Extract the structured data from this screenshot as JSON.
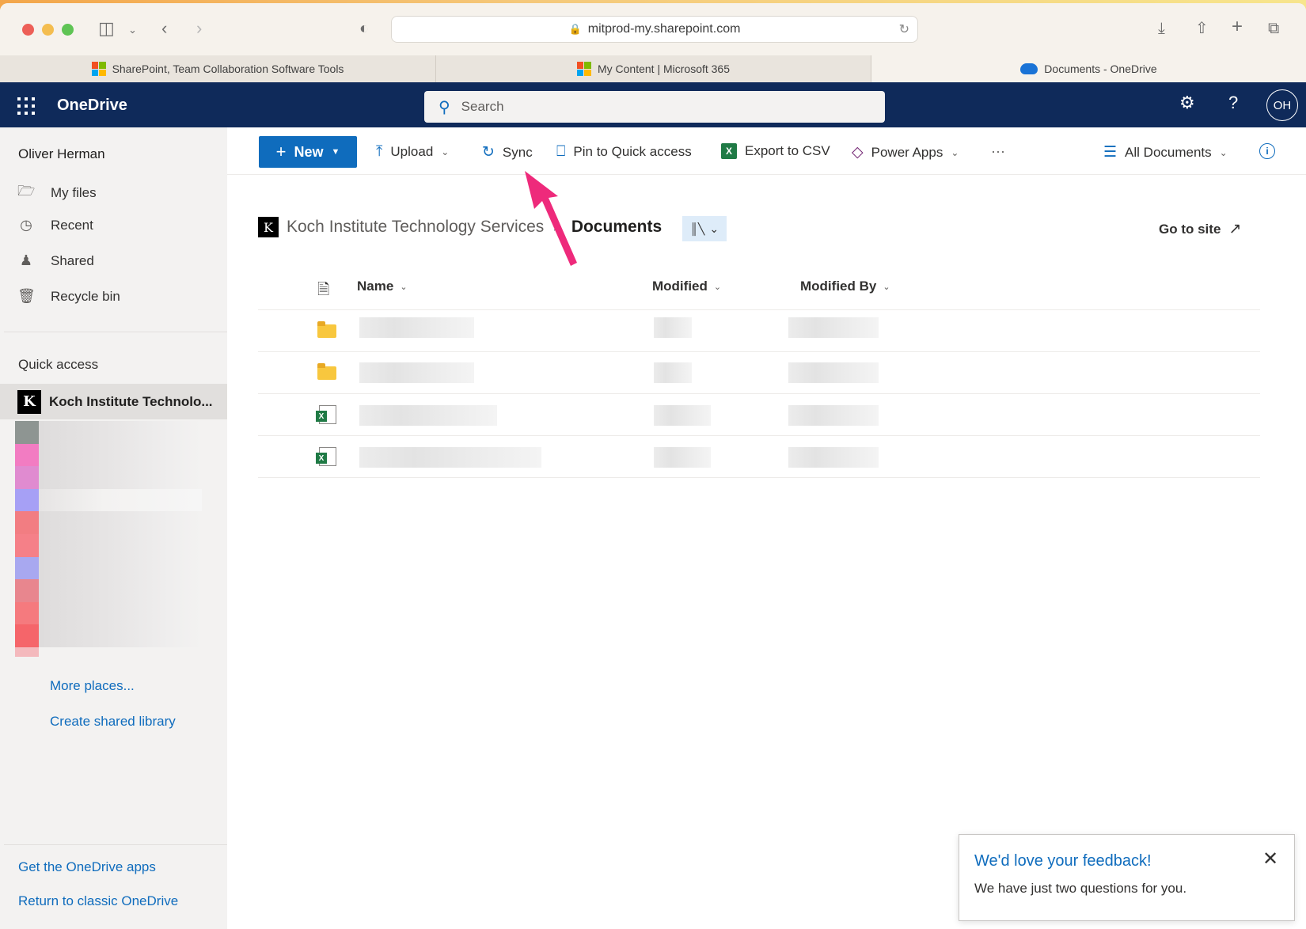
{
  "browser": {
    "url": "mitprod-my.sharepoint.com",
    "tabs": [
      {
        "label": "SharePoint, Team Collaboration Software Tools",
        "active": false
      },
      {
        "label": "My Content | Microsoft 365",
        "active": false
      },
      {
        "label": "Documents - OneDrive",
        "active": true
      }
    ]
  },
  "suite": {
    "brand": "OneDrive",
    "search_placeholder": "Search",
    "avatar_initials": "OH"
  },
  "leftnav": {
    "user": "Oliver Herman",
    "items": [
      {
        "label": "My files",
        "icon": "folder-icon"
      },
      {
        "label": "Recent",
        "icon": "clock-icon"
      },
      {
        "label": "Shared",
        "icon": "people-icon"
      },
      {
        "label": "Recycle bin",
        "icon": "trash-icon"
      }
    ],
    "quick_access_title": "Quick access",
    "quick_access_item": "Koch Institute Technolo...",
    "more_places": "More places...",
    "create_library": "Create shared library",
    "get_apps": "Get the OneDrive apps",
    "return_classic": "Return to classic OneDrive"
  },
  "commandbar": {
    "new": "New",
    "upload": "Upload",
    "sync": "Sync",
    "pin": "Pin to Quick access",
    "export": "Export to CSV",
    "power_apps": "Power Apps",
    "more": "···",
    "view": "All Documents"
  },
  "breadcrumb": {
    "site": "Koch Institute Technology Services",
    "separator": ">",
    "current": "Documents",
    "go_to_site": "Go to site"
  },
  "list": {
    "columns": {
      "name": "Name",
      "modified": "Modified",
      "modified_by": "Modified By"
    },
    "rows": [
      {
        "type": "folder"
      },
      {
        "type": "folder"
      },
      {
        "type": "excel"
      },
      {
        "type": "excel"
      }
    ]
  },
  "feedback": {
    "title": "We'd love your feedback!",
    "text": "We have just two questions for you."
  },
  "colors": {
    "suite_bar": "#0f2a5a",
    "accent": "#0f6cbd",
    "annotation_arrow": "#ee2a7b"
  }
}
